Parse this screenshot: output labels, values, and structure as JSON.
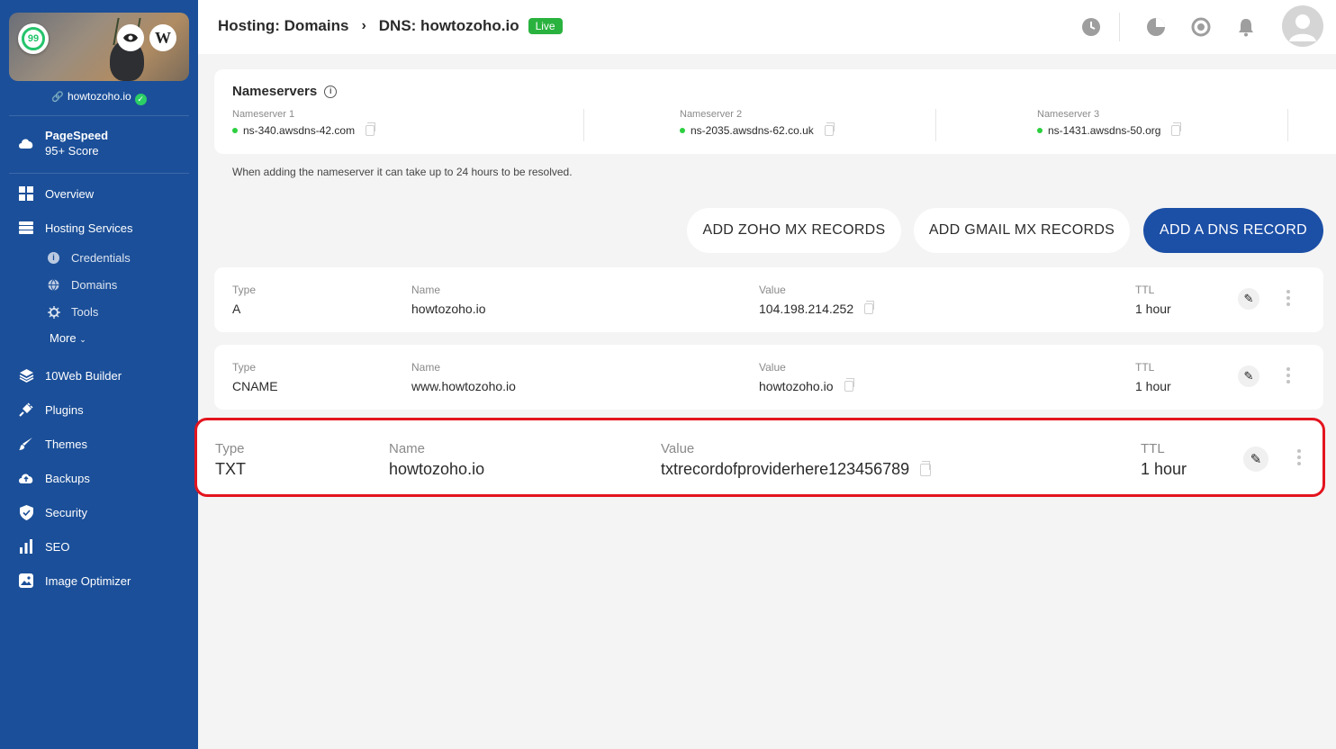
{
  "sidebar": {
    "score": "99",
    "site_name": "howtozoho.io",
    "pagespeed": {
      "title": "PageSpeed",
      "subtitle": "95+ Score"
    },
    "nav": {
      "overview": "Overview",
      "hosting_services": "Hosting Services",
      "credentials": "Credentials",
      "domains": "Domains",
      "tools": "Tools",
      "more": "More",
      "builder": "10Web Builder",
      "plugins": "Plugins",
      "themes": "Themes",
      "backups": "Backups",
      "security": "Security",
      "seo": "SEO",
      "image_optimizer": "Image Optimizer"
    }
  },
  "header": {
    "crumb_parent": "Hosting: Domains",
    "crumb_separator": "›",
    "crumb_current": "DNS: howtozoho.io",
    "status_badge": "Live"
  },
  "nameservers": {
    "title": "Nameservers",
    "items": [
      {
        "label": "Nameserver 1",
        "value": "ns-340.awsdns-42.com"
      },
      {
        "label": "Nameserver 2",
        "value": "ns-2035.awsdns-62.co.uk"
      },
      {
        "label": "Nameserver 3",
        "value": "ns-1431.awsdns-50.org"
      }
    ],
    "note": "When adding the nameserver it can take up to 24 hours to be resolved."
  },
  "actions": {
    "add_zoho": "ADD ZOHO MX RECORDS",
    "add_gmail": "ADD GMAIL MX RECORDS",
    "add_dns": "ADD A DNS RECORD"
  },
  "records": {
    "labels": {
      "type": "Type",
      "name": "Name",
      "value": "Value",
      "ttl": "TTL"
    },
    "rows": [
      {
        "type": "A",
        "name": "howtozoho.io",
        "value": "104.198.214.252",
        "ttl": "1 hour"
      },
      {
        "type": "CNAME",
        "name": "www.howtozoho.io",
        "value": "howtozoho.io",
        "ttl": "1 hour"
      },
      {
        "type": "TXT",
        "name": "howtozoho.io",
        "value": "txtrecordofproviderhere123456789",
        "ttl": "1 hour"
      }
    ]
  },
  "colors": {
    "sidebar_bg": "#1b4f99",
    "primary_button": "#1c4fa6",
    "live_badge": "#2ab23f",
    "highlight_border": "#e3141e"
  }
}
